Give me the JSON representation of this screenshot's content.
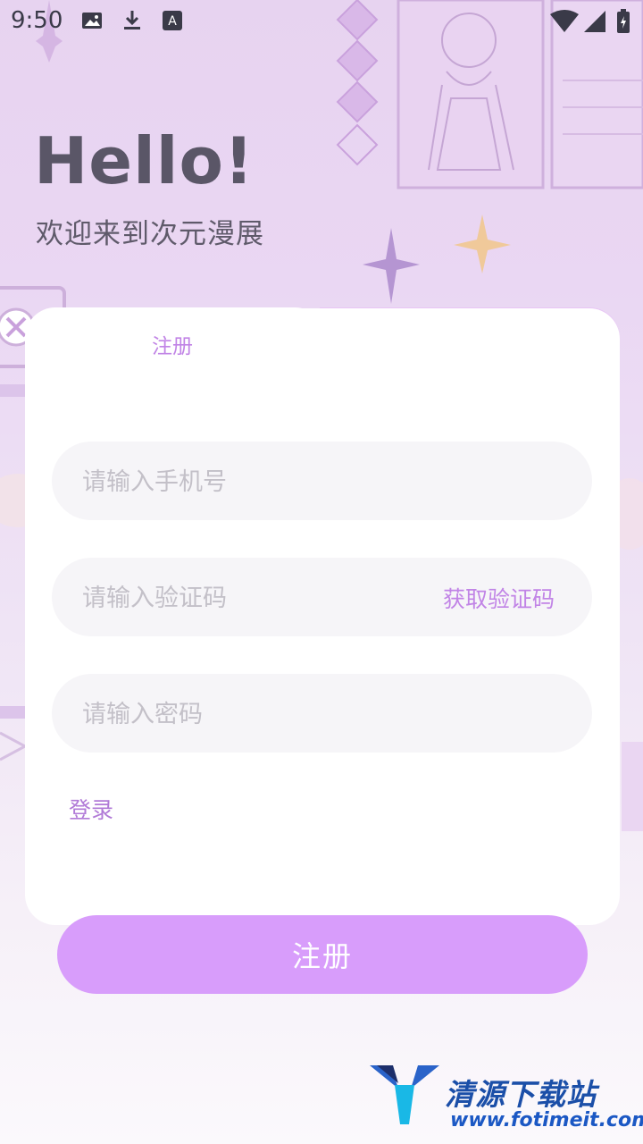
{
  "status_bar": {
    "time": "9:50"
  },
  "header": {
    "greeting": "Hello!",
    "subtitle": "欢迎来到次元漫展"
  },
  "tabs": {
    "register_label": "注册"
  },
  "form": {
    "phone_placeholder": "请输入手机号",
    "code_placeholder": "请输入验证码",
    "get_code_label": "获取验证码",
    "password_placeholder": "请输入密码",
    "login_link": "登录",
    "submit_label": "注册"
  },
  "watermark": {
    "brand": "清源下载站",
    "url": "www.fotimeit.com"
  },
  "colors": {
    "accent": "#d89dfb",
    "accent_text": "#c184e6",
    "tab_inactive": "#e8c4f5",
    "field_bg": "#f6f5f8"
  }
}
